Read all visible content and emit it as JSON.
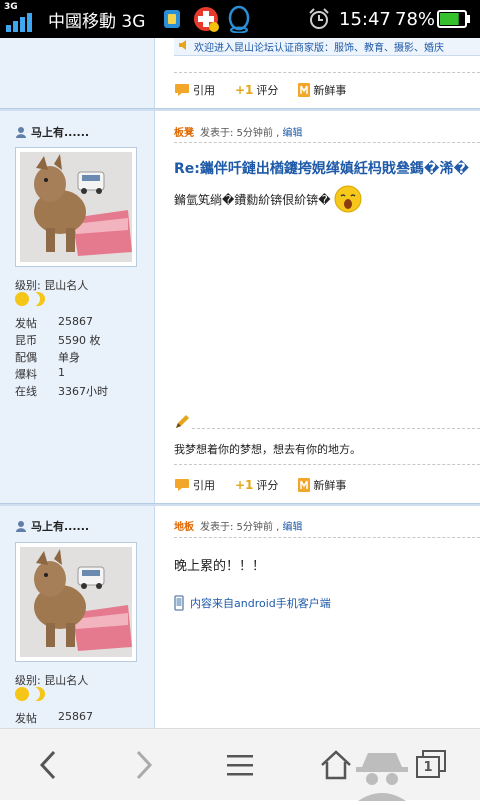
{
  "status_bar": {
    "network_type": "3G",
    "carrier": "中國移動 3G",
    "time": "15:47",
    "battery": "78%",
    "battery_level": 0.78
  },
  "top_partial": {
    "banner_text": "欢迎进入昆山论坛认证商家版：服饰、教育、摄影、婚庆",
    "quote_label": "引用",
    "rate_label": "评分",
    "fresh_label": "新鲜事"
  },
  "posts": [
    {
      "author": "马上有......",
      "level_label": "级别: 昆山名人",
      "stats": [
        {
          "key": "发帖",
          "value": "25867"
        },
        {
          "key": "昆币",
          "value": "5590 枚"
        },
        {
          "key": "配偶",
          "value": "单身"
        },
        {
          "key": "爆料",
          "value": "1"
        },
        {
          "key": "在线",
          "value": "3367小时"
        }
      ],
      "floor": "板凳",
      "posted": "发表于: 5分钟前 ,",
      "edit": "编辑",
      "title": "Re:鑴伴吀鏈出楢鑳挎娊缂嫃紝杩戝叄鎷�浠�",
      "body": "鏅氫笂绱�鐨勬紒锛佷紒锛�",
      "signature": "我梦想着你的梦想，想去有你的地方。",
      "quote_label": "引用",
      "rate_label": "评分",
      "fresh_label": "新鲜事"
    },
    {
      "author": "马上有......",
      "level_label": "级别: 昆山名人",
      "stats": [
        {
          "key": "发帖",
          "value": "25867"
        }
      ],
      "floor": "地板",
      "posted": "发表于: 5分钟前 ,",
      "edit": "编辑",
      "body": "晚上累的！！！",
      "client_note": "内容来自android手机客户端"
    }
  ],
  "nav": {
    "tab_count": "1"
  },
  "colors": {
    "link_blue": "#1e5aa8",
    "floor_orange": "#e06800",
    "sidebar_bg": "#e9f1fb"
  }
}
